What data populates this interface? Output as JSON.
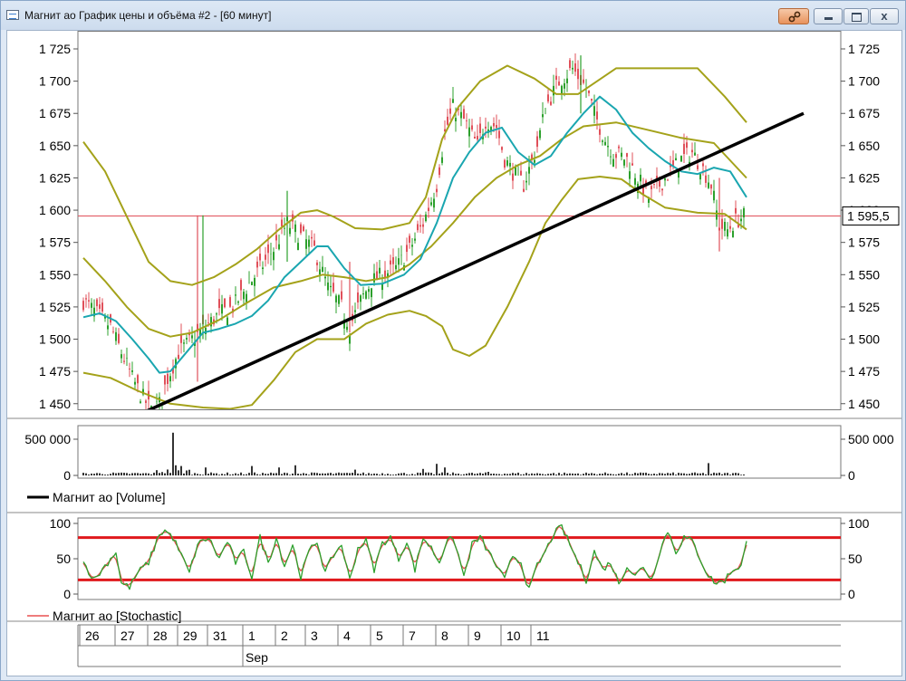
{
  "window": {
    "title": "Магнит ао График цены и объёма #2 - [60 минут]",
    "icons": {
      "app": "chart-window-icon",
      "pin": "link-icon",
      "minimize": "minimize-icon",
      "maximize": "maximize-icon",
      "close": "close-icon"
    },
    "close_glyph": "x"
  },
  "colors": {
    "candle_up": "#2ca02c",
    "candle_down": "#e0505a",
    "bollinger": "#a4a21a",
    "ma": "#1aa6b0",
    "trendline": "#000000",
    "price_line": "#e0505a",
    "level": "#e0181c",
    "stoch_k": "#2ca02c",
    "stoch_d": "#e85050",
    "volume": "#000000"
  },
  "chart_data": [
    {
      "type": "candlestick",
      "panel": "price",
      "ylim": [
        1440,
        1725
      ],
      "y_ticks": [
        "1 725",
        "1 700",
        "1 675",
        "1 650",
        "1 625",
        "1 600",
        "1 575",
        "1 550",
        "1 525",
        "1 500",
        "1 475",
        "1 450"
      ],
      "y_tick_values": [
        1725,
        1700,
        1675,
        1650,
        1625,
        1600,
        1575,
        1550,
        1525,
        1500,
        1475,
        1450
      ],
      "current_price_label": "1 595,5",
      "current_price": 1595.5,
      "close_points": [
        [
          0,
          1530
        ],
        [
          5,
          1520
        ],
        [
          10,
          1510
        ],
        [
          14,
          1490
        ],
        [
          18,
          1470
        ],
        [
          21,
          1458
        ],
        [
          25,
          1445
        ],
        [
          28,
          1450
        ],
        [
          31,
          1470
        ],
        [
          35,
          1490
        ],
        [
          40,
          1500
        ],
        [
          45,
          1510
        ],
        [
          50,
          1520
        ],
        [
          55,
          1525
        ],
        [
          60,
          1540
        ],
        [
          65,
          1555
        ],
        [
          70,
          1570
        ],
        [
          75,
          1590
        ],
        [
          80,
          1580
        ],
        [
          85,
          1570
        ],
        [
          90,
          1540
        ],
        [
          95,
          1525
        ],
        [
          98,
          1510
        ],
        [
          102,
          1530
        ],
        [
          106,
          1545
        ],
        [
          110,
          1550
        ],
        [
          115,
          1555
        ],
        [
          120,
          1570
        ],
        [
          125,
          1590
        ],
        [
          130,
          1620
        ],
        [
          133,
          1660
        ],
        [
          136,
          1680
        ],
        [
          140,
          1670
        ],
        [
          145,
          1650
        ],
        [
          148,
          1670
        ],
        [
          152,
          1665
        ],
        [
          155,
          1640
        ],
        [
          158,
          1630
        ],
        [
          162,
          1620
        ],
        [
          167,
          1650
        ],
        [
          170,
          1680
        ],
        [
          175,
          1700
        ],
        [
          180,
          1710
        ],
        [
          185,
          1695
        ],
        [
          188,
          1675
        ],
        [
          192,
          1655
        ],
        [
          195,
          1645
        ],
        [
          200,
          1640
        ],
        [
          204,
          1625
        ],
        [
          208,
          1610
        ],
        [
          212,
          1620
        ],
        [
          216,
          1630
        ],
        [
          220,
          1640
        ],
        [
          224,
          1645
        ],
        [
          228,
          1632
        ],
        [
          231,
          1620
        ],
        [
          234,
          1588
        ],
        [
          237,
          1585
        ],
        [
          240,
          1592
        ],
        [
          243,
          1595.5
        ]
      ],
      "bollinger_upper": [
        [
          0,
          1653
        ],
        [
          8,
          1630
        ],
        [
          16,
          1595
        ],
        [
          24,
          1560
        ],
        [
          32,
          1545
        ],
        [
          40,
          1542
        ],
        [
          48,
          1548
        ],
        [
          56,
          1558
        ],
        [
          64,
          1570
        ],
        [
          72,
          1585
        ],
        [
          80,
          1598
        ],
        [
          86,
          1600
        ],
        [
          92,
          1595
        ],
        [
          100,
          1586
        ],
        [
          110,
          1585
        ],
        [
          120,
          1590
        ],
        [
          126,
          1610
        ],
        [
          132,
          1655
        ],
        [
          138,
          1680
        ],
        [
          146,
          1700
        ],
        [
          156,
          1712
        ],
        [
          166,
          1702
        ],
        [
          174,
          1690
        ],
        [
          182,
          1690
        ],
        [
          196,
          1710
        ],
        [
          212,
          1710
        ],
        [
          226,
          1710
        ],
        [
          236,
          1688
        ],
        [
          244,
          1668
        ]
      ],
      "bollinger_middle": [
        [
          0,
          1563
        ],
        [
          8,
          1545
        ],
        [
          16,
          1525
        ],
        [
          24,
          1508
        ],
        [
          32,
          1502
        ],
        [
          40,
          1505
        ],
        [
          50,
          1515
        ],
        [
          60,
          1528
        ],
        [
          70,
          1540
        ],
        [
          80,
          1545
        ],
        [
          88,
          1550
        ],
        [
          96,
          1548
        ],
        [
          104,
          1545
        ],
        [
          112,
          1548
        ],
        [
          120,
          1558
        ],
        [
          128,
          1572
        ],
        [
          136,
          1590
        ],
        [
          144,
          1610
        ],
        [
          152,
          1625
        ],
        [
          160,
          1635
        ],
        [
          168,
          1642
        ],
        [
          176,
          1655
        ],
        [
          184,
          1665
        ],
        [
          196,
          1668
        ],
        [
          208,
          1662
        ],
        [
          220,
          1656
        ],
        [
          232,
          1652
        ],
        [
          244,
          1625
        ]
      ],
      "bollinger_lower": [
        [
          0,
          1474
        ],
        [
          10,
          1470
        ],
        [
          20,
          1460
        ],
        [
          32,
          1450
        ],
        [
          44,
          1447
        ],
        [
          54,
          1446
        ],
        [
          62,
          1449
        ],
        [
          70,
          1468
        ],
        [
          78,
          1490
        ],
        [
          86,
          1500
        ],
        [
          96,
          1500
        ],
        [
          104,
          1512
        ],
        [
          112,
          1519
        ],
        [
          120,
          1522
        ],
        [
          126,
          1518
        ],
        [
          132,
          1510
        ],
        [
          136,
          1492
        ],
        [
          142,
          1487
        ],
        [
          148,
          1495
        ],
        [
          156,
          1525
        ],
        [
          164,
          1560
        ],
        [
          170,
          1590
        ],
        [
          176,
          1608
        ],
        [
          182,
          1624
        ],
        [
          190,
          1626
        ],
        [
          198,
          1624
        ],
        [
          206,
          1612
        ],
        [
          214,
          1602
        ],
        [
          226,
          1598
        ],
        [
          236,
          1597
        ],
        [
          244,
          1585
        ]
      ],
      "ma": [
        [
          0,
          1517
        ],
        [
          6,
          1520
        ],
        [
          12,
          1514
        ],
        [
          18,
          1500
        ],
        [
          24,
          1485
        ],
        [
          28,
          1474
        ],
        [
          32,
          1475
        ],
        [
          38,
          1490
        ],
        [
          44,
          1505
        ],
        [
          50,
          1508
        ],
        [
          56,
          1512
        ],
        [
          62,
          1518
        ],
        [
          68,
          1530
        ],
        [
          74,
          1548
        ],
        [
          80,
          1560
        ],
        [
          86,
          1572
        ],
        [
          90,
          1572
        ],
        [
          96,
          1555
        ],
        [
          102,
          1542
        ],
        [
          110,
          1543
        ],
        [
          118,
          1550
        ],
        [
          124,
          1562
        ],
        [
          130,
          1590
        ],
        [
          136,
          1625
        ],
        [
          142,
          1645
        ],
        [
          148,
          1660
        ],
        [
          154,
          1664
        ],
        [
          160,
          1645
        ],
        [
          166,
          1635
        ],
        [
          172,
          1642
        ],
        [
          178,
          1660
        ],
        [
          184,
          1675
        ],
        [
          190,
          1688
        ],
        [
          196,
          1678
        ],
        [
          202,
          1660
        ],
        [
          208,
          1648
        ],
        [
          214,
          1638
        ],
        [
          220,
          1630
        ],
        [
          226,
          1628
        ],
        [
          232,
          1633
        ],
        [
          238,
          1630
        ],
        [
          244,
          1610
        ]
      ],
      "trendline": [
        [
          22,
          1443
        ],
        [
          265,
          1675
        ]
      ],
      "n_bars": 244
    },
    {
      "type": "bar",
      "panel": "volume",
      "ylim": [
        0,
        650000
      ],
      "y_ticks": [
        "500 000",
        "0"
      ],
      "y_tick_values": [
        500000,
        0
      ],
      "series": [
        {
          "name": "Магнит ао [Volume]"
        }
      ],
      "spikes": [
        [
          33,
          590000
        ],
        [
          34,
          140000
        ],
        [
          36,
          130000
        ],
        [
          45,
          110000
        ],
        [
          62,
          130000
        ],
        [
          72,
          110000
        ],
        [
          78,
          140000
        ],
        [
          100,
          80000
        ],
        [
          125,
          90000
        ],
        [
          130,
          160000
        ],
        [
          133,
          110000
        ],
        [
          149,
          50000
        ],
        [
          230,
          170000
        ]
      ],
      "base_level": 30000
    },
    {
      "type": "line",
      "panel": "stochastic",
      "ylim": [
        0,
        100
      ],
      "y_ticks": [
        "100",
        "50",
        "0"
      ],
      "y_tick_values": [
        100,
        50,
        0
      ],
      "levels": [
        80,
        20
      ],
      "series": [
        {
          "name": "Магнит ао [Stochastic]"
        }
      ],
      "points": [
        [
          0,
          45
        ],
        [
          4,
          20
        ],
        [
          8,
          40
        ],
        [
          12,
          60
        ],
        [
          14,
          15
        ],
        [
          17,
          10
        ],
        [
          20,
          30
        ],
        [
          24,
          45
        ],
        [
          28,
          85
        ],
        [
          30,
          90
        ],
        [
          33,
          80
        ],
        [
          36,
          55
        ],
        [
          39,
          30
        ],
        [
          42,
          70
        ],
        [
          46,
          80
        ],
        [
          50,
          50
        ],
        [
          53,
          75
        ],
        [
          56,
          45
        ],
        [
          59,
          60
        ],
        [
          62,
          25
        ],
        [
          65,
          80
        ],
        [
          68,
          45
        ],
        [
          71,
          80
        ],
        [
          74,
          40
        ],
        [
          77,
          70
        ],
        [
          80,
          25
        ],
        [
          83,
          60
        ],
        [
          86,
          75
        ],
        [
          89,
          30
        ],
        [
          92,
          55
        ],
        [
          95,
          70
        ],
        [
          98,
          20
        ],
        [
          101,
          65
        ],
        [
          104,
          75
        ],
        [
          107,
          35
        ],
        [
          110,
          72
        ],
        [
          113,
          80
        ],
        [
          116,
          50
        ],
        [
          119,
          75
        ],
        [
          122,
          35
        ],
        [
          125,
          80
        ],
        [
          128,
          65
        ],
        [
          131,
          45
        ],
        [
          134,
          80
        ],
        [
          137,
          70
        ],
        [
          140,
          25
        ],
        [
          143,
          70
        ],
        [
          146,
          80
        ],
        [
          149,
          60
        ],
        [
          152,
          40
        ],
        [
          155,
          20
        ],
        [
          158,
          55
        ],
        [
          161,
          45
        ],
        [
          164,
          5
        ],
        [
          167,
          40
        ],
        [
          170,
          60
        ],
        [
          173,
          85
        ],
        [
          176,
          95
        ],
        [
          179,
          70
        ],
        [
          182,
          45
        ],
        [
          185,
          20
        ],
        [
          188,
          60
        ],
        [
          191,
          35
        ],
        [
          194,
          45
        ],
        [
          197,
          15
        ],
        [
          200,
          40
        ],
        [
          203,
          25
        ],
        [
          206,
          40
        ],
        [
          209,
          20
        ],
        [
          212,
          60
        ],
        [
          215,
          90
        ],
        [
          218,
          60
        ],
        [
          221,
          80
        ],
        [
          224,
          75
        ],
        [
          227,
          50
        ],
        [
          230,
          25
        ],
        [
          233,
          15
        ],
        [
          236,
          20
        ],
        [
          239,
          35
        ],
        [
          242,
          40
        ],
        [
          244,
          72
        ]
      ]
    }
  ],
  "time_axis": {
    "days": [
      "26",
      "27",
      "28",
      "29",
      "31",
      "1",
      "2",
      "3",
      "4",
      "5",
      "7",
      "8",
      "9",
      "10",
      "11"
    ],
    "day_bar_index": [
      0,
      13,
      25,
      36,
      47,
      60,
      72,
      83,
      95,
      107,
      119,
      131,
      143,
      155,
      166
    ],
    "month_label": "Sep",
    "month_bar_index": 60
  },
  "legends": {
    "volume": "Магнит ао [Volume]",
    "stochastic": "Магнит ао [Stochastic]"
  }
}
